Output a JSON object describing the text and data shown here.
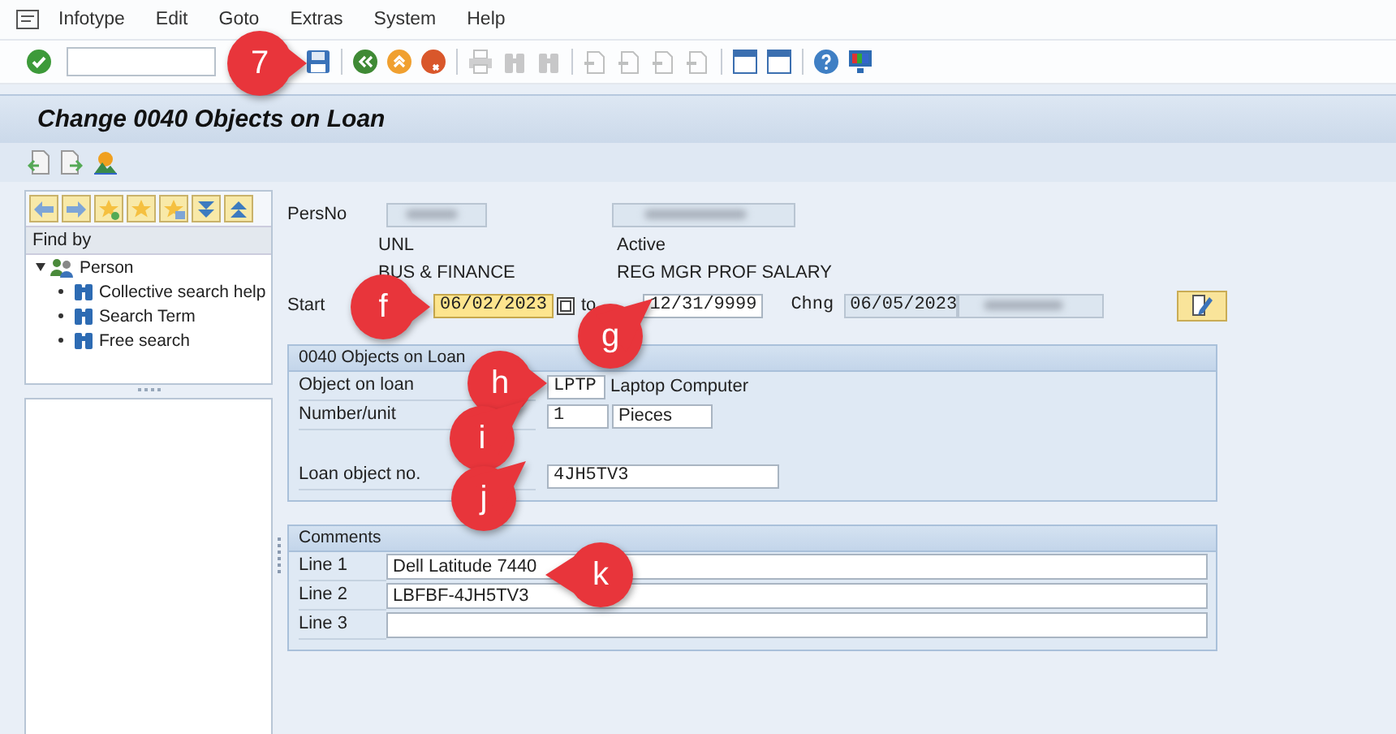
{
  "menu_bar": [
    {
      "label": "Infotype"
    },
    {
      "label": "Edit"
    },
    {
      "label": "Goto"
    },
    {
      "label": "Extras"
    },
    {
      "label": "System"
    },
    {
      "label": "Help"
    }
  ],
  "toolbar": [
    {
      "kind": "enter",
      "disabled": false
    },
    {
      "kind": "command"
    },
    {
      "kind": "save",
      "disabled": false
    },
    {
      "kind": "separator"
    },
    {
      "kind": "back",
      "disabled": false
    },
    {
      "kind": "exit",
      "disabled": false
    },
    {
      "kind": "cancel",
      "disabled": false
    },
    {
      "kind": "separator"
    },
    {
      "kind": "print",
      "disabled": true
    },
    {
      "kind": "find",
      "disabled": true
    },
    {
      "kind": "find",
      "disabled": true
    },
    {
      "kind": "separator"
    },
    {
      "kind": "page",
      "disabled": true
    },
    {
      "kind": "page",
      "disabled": true
    },
    {
      "kind": "page",
      "disabled": true
    },
    {
      "kind": "page",
      "disabled": true
    },
    {
      "kind": "separator"
    },
    {
      "kind": "window",
      "disabled": false
    },
    {
      "kind": "window",
      "disabled": false
    },
    {
      "kind": "separator"
    },
    {
      "kind": "help",
      "disabled": false
    },
    {
      "kind": "monitor",
      "disabled": false
    }
  ],
  "title": "Change 0040 Objects on Loan",
  "navigator": {
    "header": "Find by",
    "tree": [
      {
        "label": "Person",
        "expanded": true,
        "children": [
          {
            "label": "Collective search help"
          },
          {
            "label": "Search Term"
          },
          {
            "label": "Free search"
          }
        ]
      }
    ]
  },
  "header": {
    "pers_no_label": "PersNo",
    "info": [
      [
        "UNL",
        "Active"
      ],
      [
        "BUS & FINANCE",
        "REG MGR PROF SALARY"
      ]
    ],
    "start_label": "Start",
    "start": {
      "value": "06/02/2023",
      "focused": true
    },
    "to_label": "to",
    "end": {
      "value": "12/31/9999",
      "focused": false
    },
    "chng_label": "Chng",
    "chng": "06/05/2023"
  },
  "objects_group": {
    "title": "0040 Objects on Loan",
    "object_label": "Object on loan",
    "object_code": "LPTP",
    "object_text": "Laptop Computer",
    "number_label": "Number/unit",
    "number": "1",
    "unit": "Pieces",
    "loan_no_label": "Loan object no.",
    "loan_no": "4JH5TV3"
  },
  "comments": {
    "title": "Comments",
    "lines": [
      {
        "label": "Line 1",
        "value": "Dell Latitude 7440"
      },
      {
        "label": "Line 2",
        "value": "LBFBF-4JH5TV3"
      },
      {
        "label": "Line 3"
      }
    ]
  },
  "callouts": [
    {
      "label": "7",
      "kind": "right"
    },
    {
      "label": "f",
      "kind": "right"
    },
    {
      "label": "g",
      "kind": "upright"
    },
    {
      "label": "h",
      "kind": "right"
    },
    {
      "label": "i",
      "kind": "upright"
    },
    {
      "label": "j",
      "kind": "upright"
    },
    {
      "label": "k",
      "kind": "left"
    }
  ]
}
